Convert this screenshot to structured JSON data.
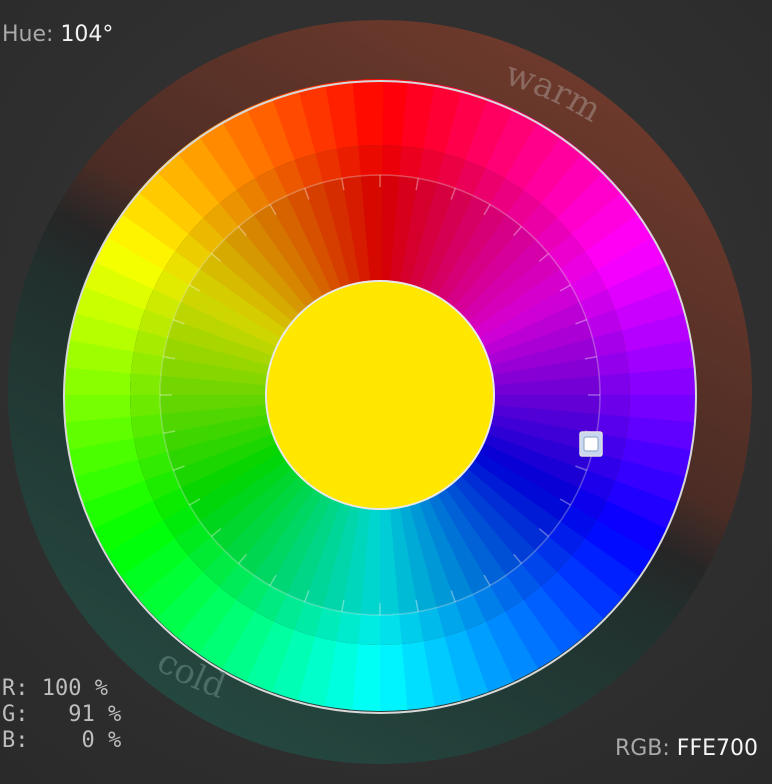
{
  "hue": {
    "label": "Hue:",
    "value": "104°"
  },
  "wheel": {
    "warm_label": "warm",
    "cold_label": "cold",
    "center_color": "#FFE700",
    "warm_ring_color": "#6e3a2c",
    "cold_ring_color": "#244840",
    "segments": 12
  },
  "rgb_percent": {
    "r_label": "R:",
    "r_value": "100 %",
    "g_label": "G:",
    "g_value": "91 %",
    "b_label": "B:",
    "b_value": "0 %"
  },
  "rgb_hex": {
    "label": "RGB:",
    "value": "FFE700"
  }
}
